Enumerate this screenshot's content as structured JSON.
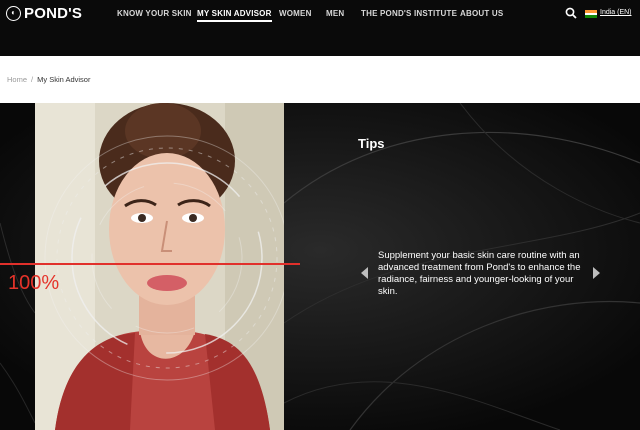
{
  "brand": {
    "name": "POND'S"
  },
  "nav": {
    "items": [
      {
        "label": "KNOW YOUR SKIN"
      },
      {
        "label": "MY SKIN ADVISOR",
        "active": true
      },
      {
        "label": "WOMEN"
      },
      {
        "label": "MEN"
      },
      {
        "label": "THE POND'S INSTITUTE"
      },
      {
        "label": "ABOUT US"
      }
    ],
    "search_icon": "search-icon",
    "region_label": "India (EN)",
    "flag_colors": [
      "#FF9933",
      "#FFFFFF",
      "#138808"
    ]
  },
  "breadcrumb": {
    "home": "Home",
    "separator": "/",
    "current": "My Skin Advisor"
  },
  "advisor": {
    "scan_percent": "100%",
    "tips_title": "Tips",
    "tip_text": "Supplement your basic skin care routine with an advanced treatment from Pond's to enhance the radiance, fairness and younger-looking of your skin."
  },
  "colors": {
    "accent": "#E1302B",
    "header_bg": "#0A0A0A",
    "main_bg": "#0B0B0B"
  }
}
